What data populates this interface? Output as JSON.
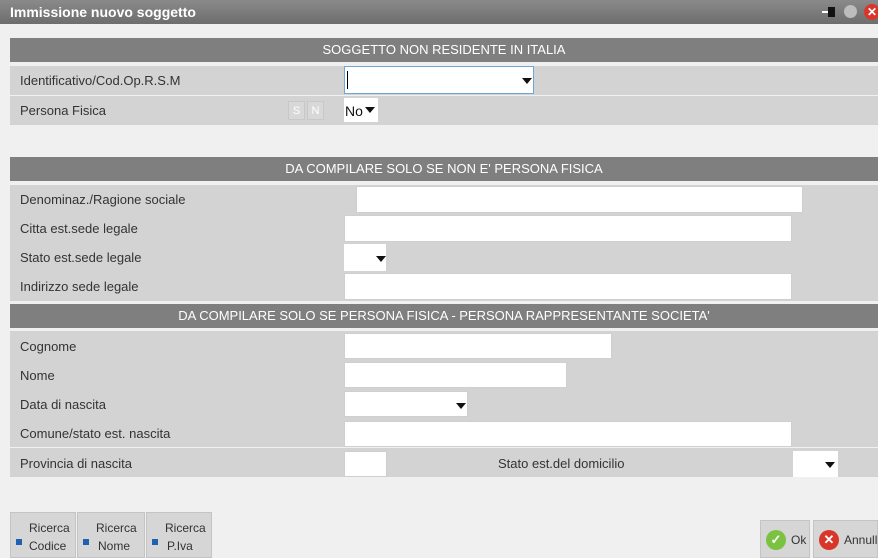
{
  "window": {
    "title": "Immissione nuovo soggetto"
  },
  "sections": {
    "s1": "SOGGETTO NON RESIDENTE IN ITALIA",
    "s2": "DA COMPILARE SOLO SE NON E' PERSONA FISICA",
    "s3": "DA COMPILARE SOLO SE PERSONA FISICA - PERSONA RAPPRESENTANTE SOCIETA'"
  },
  "fields": {
    "identificativo": {
      "label": "Identificativo/Cod.Op.R.S.M",
      "value": ""
    },
    "persona_fisica": {
      "label": "Persona Fisica",
      "s": "S",
      "n": "N",
      "value": "No"
    },
    "denominazione": {
      "label": "Denominaz./Ragione sociale",
      "value": ""
    },
    "citta_sede": {
      "label": "Citta est.sede legale",
      "value": ""
    },
    "stato_sede": {
      "label": "Stato est.sede legale",
      "value": ""
    },
    "indirizzo_sede": {
      "label": "Indirizzo sede legale",
      "value": ""
    },
    "cognome": {
      "label": "Cognome",
      "value": ""
    },
    "nome": {
      "label": "Nome",
      "value": ""
    },
    "data_nascita": {
      "label": "Data di nascita",
      "value": ""
    },
    "comune_nascita": {
      "label": "Comune/stato est. nascita",
      "value": ""
    },
    "provincia_nascita": {
      "label": "Provincia di nascita",
      "value": ""
    },
    "stato_domicilio": {
      "label": "Stato est.del domicilio",
      "value": ""
    }
  },
  "footer": {
    "ricerca_codice": {
      "line1": "Ricerca",
      "line2": "Codice"
    },
    "ricerca_nome": {
      "line1": "Ricerca",
      "line2": "Nome"
    },
    "ricerca_piva": {
      "line1": "Ricerca",
      "line2": "P.Iva"
    },
    "ok": "Ok",
    "annulla": "Annull"
  },
  "icons": [
    "pin-icon",
    "circle-icon",
    "close-icon",
    "dropdown-arrow-icon",
    "ok-check-icon",
    "cancel-x-icon"
  ],
  "colors": {
    "titlebar": "#7a7a7a",
    "section": "#7f7f7f",
    "row": "#d3d3d3",
    "ok": "#7cc242",
    "cancel": "#d9362b",
    "accent": "#2060b0"
  }
}
